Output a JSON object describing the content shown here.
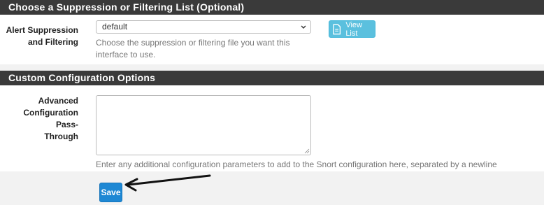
{
  "suppression_section": {
    "title": "Choose a Suppression or Filtering List (Optional)",
    "label_line1": "Alert Suppression",
    "label_line2": "and Filtering",
    "select_value": "default",
    "help_line1": "Choose the suppression or filtering file you want this",
    "help_line2": "interface to use.",
    "view_button_label": "View List",
    "view_button_icon": "document-icon"
  },
  "custom_section": {
    "title": "Custom Configuration Options",
    "label_line1": "Advanced",
    "label_line2": "Configuration Pass-",
    "label_line3": "Through",
    "textarea_value": "",
    "help": "Enter any additional configuration parameters to add to the Snort configuration here, separated by a newline"
  },
  "footer": {
    "save_label": "Save"
  },
  "colors": {
    "header_bg": "#3a3a3a",
    "info_button": "#5bc0de",
    "primary_button": "#1e88d4",
    "page_bg": "#f2f2f2"
  }
}
